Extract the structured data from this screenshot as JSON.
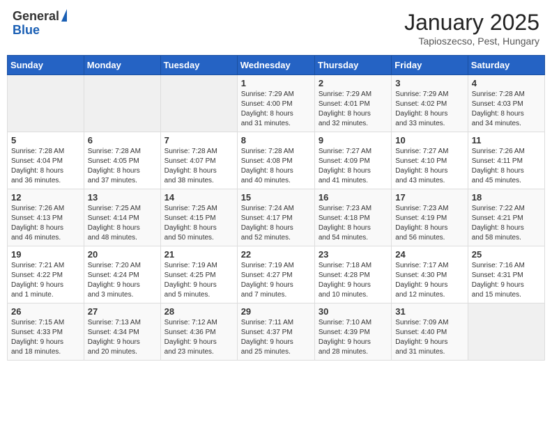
{
  "logo": {
    "general": "General",
    "blue": "Blue"
  },
  "header": {
    "month": "January 2025",
    "location": "Tapioszecso, Pest, Hungary"
  },
  "weekdays": [
    "Sunday",
    "Monday",
    "Tuesday",
    "Wednesday",
    "Thursday",
    "Friday",
    "Saturday"
  ],
  "weeks": [
    [
      {
        "day": "",
        "content": ""
      },
      {
        "day": "",
        "content": ""
      },
      {
        "day": "",
        "content": ""
      },
      {
        "day": "1",
        "content": "Sunrise: 7:29 AM\nSunset: 4:00 PM\nDaylight: 8 hours\nand 31 minutes."
      },
      {
        "day": "2",
        "content": "Sunrise: 7:29 AM\nSunset: 4:01 PM\nDaylight: 8 hours\nand 32 minutes."
      },
      {
        "day": "3",
        "content": "Sunrise: 7:29 AM\nSunset: 4:02 PM\nDaylight: 8 hours\nand 33 minutes."
      },
      {
        "day": "4",
        "content": "Sunrise: 7:28 AM\nSunset: 4:03 PM\nDaylight: 8 hours\nand 34 minutes."
      }
    ],
    [
      {
        "day": "5",
        "content": "Sunrise: 7:28 AM\nSunset: 4:04 PM\nDaylight: 8 hours\nand 36 minutes."
      },
      {
        "day": "6",
        "content": "Sunrise: 7:28 AM\nSunset: 4:05 PM\nDaylight: 8 hours\nand 37 minutes."
      },
      {
        "day": "7",
        "content": "Sunrise: 7:28 AM\nSunset: 4:07 PM\nDaylight: 8 hours\nand 38 minutes."
      },
      {
        "day": "8",
        "content": "Sunrise: 7:28 AM\nSunset: 4:08 PM\nDaylight: 8 hours\nand 40 minutes."
      },
      {
        "day": "9",
        "content": "Sunrise: 7:27 AM\nSunset: 4:09 PM\nDaylight: 8 hours\nand 41 minutes."
      },
      {
        "day": "10",
        "content": "Sunrise: 7:27 AM\nSunset: 4:10 PM\nDaylight: 8 hours\nand 43 minutes."
      },
      {
        "day": "11",
        "content": "Sunrise: 7:26 AM\nSunset: 4:11 PM\nDaylight: 8 hours\nand 45 minutes."
      }
    ],
    [
      {
        "day": "12",
        "content": "Sunrise: 7:26 AM\nSunset: 4:13 PM\nDaylight: 8 hours\nand 46 minutes."
      },
      {
        "day": "13",
        "content": "Sunrise: 7:25 AM\nSunset: 4:14 PM\nDaylight: 8 hours\nand 48 minutes."
      },
      {
        "day": "14",
        "content": "Sunrise: 7:25 AM\nSunset: 4:15 PM\nDaylight: 8 hours\nand 50 minutes."
      },
      {
        "day": "15",
        "content": "Sunrise: 7:24 AM\nSunset: 4:17 PM\nDaylight: 8 hours\nand 52 minutes."
      },
      {
        "day": "16",
        "content": "Sunrise: 7:23 AM\nSunset: 4:18 PM\nDaylight: 8 hours\nand 54 minutes."
      },
      {
        "day": "17",
        "content": "Sunrise: 7:23 AM\nSunset: 4:19 PM\nDaylight: 8 hours\nand 56 minutes."
      },
      {
        "day": "18",
        "content": "Sunrise: 7:22 AM\nSunset: 4:21 PM\nDaylight: 8 hours\nand 58 minutes."
      }
    ],
    [
      {
        "day": "19",
        "content": "Sunrise: 7:21 AM\nSunset: 4:22 PM\nDaylight: 9 hours\nand 1 minute."
      },
      {
        "day": "20",
        "content": "Sunrise: 7:20 AM\nSunset: 4:24 PM\nDaylight: 9 hours\nand 3 minutes."
      },
      {
        "day": "21",
        "content": "Sunrise: 7:19 AM\nSunset: 4:25 PM\nDaylight: 9 hours\nand 5 minutes."
      },
      {
        "day": "22",
        "content": "Sunrise: 7:19 AM\nSunset: 4:27 PM\nDaylight: 9 hours\nand 7 minutes."
      },
      {
        "day": "23",
        "content": "Sunrise: 7:18 AM\nSunset: 4:28 PM\nDaylight: 9 hours\nand 10 minutes."
      },
      {
        "day": "24",
        "content": "Sunrise: 7:17 AM\nSunset: 4:30 PM\nDaylight: 9 hours\nand 12 minutes."
      },
      {
        "day": "25",
        "content": "Sunrise: 7:16 AM\nSunset: 4:31 PM\nDaylight: 9 hours\nand 15 minutes."
      }
    ],
    [
      {
        "day": "26",
        "content": "Sunrise: 7:15 AM\nSunset: 4:33 PM\nDaylight: 9 hours\nand 18 minutes."
      },
      {
        "day": "27",
        "content": "Sunrise: 7:13 AM\nSunset: 4:34 PM\nDaylight: 9 hours\nand 20 minutes."
      },
      {
        "day": "28",
        "content": "Sunrise: 7:12 AM\nSunset: 4:36 PM\nDaylight: 9 hours\nand 23 minutes."
      },
      {
        "day": "29",
        "content": "Sunrise: 7:11 AM\nSunset: 4:37 PM\nDaylight: 9 hours\nand 25 minutes."
      },
      {
        "day": "30",
        "content": "Sunrise: 7:10 AM\nSunset: 4:39 PM\nDaylight: 9 hours\nand 28 minutes."
      },
      {
        "day": "31",
        "content": "Sunrise: 7:09 AM\nSunset: 4:40 PM\nDaylight: 9 hours\nand 31 minutes."
      },
      {
        "day": "",
        "content": ""
      }
    ]
  ]
}
